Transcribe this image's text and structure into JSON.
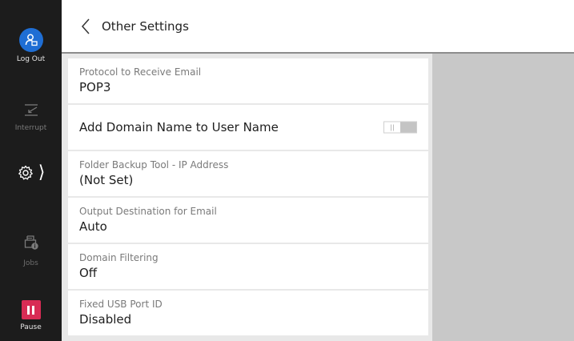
{
  "sidebar": {
    "logout_label": "Log Out",
    "interrupt_label": "Interrupt",
    "jobs_label": "Jobs",
    "pause_label": "Pause"
  },
  "header": {
    "title": "Other Settings"
  },
  "settings": {
    "protocol": {
      "label": "Protocol to Receive Email",
      "value": "POP3"
    },
    "domain_name": {
      "label": "Add Domain Name to User Name",
      "enabled": false
    },
    "folder_backup": {
      "label": "Folder Backup Tool - IP Address",
      "value": "(Not Set)"
    },
    "output_destination": {
      "label": "Output Destination for Email",
      "value": "Auto"
    },
    "domain_filtering": {
      "label": "Domain Filtering",
      "value": "Off"
    },
    "fixed_usb": {
      "label": "Fixed USB Port ID",
      "value": "Disabled"
    }
  },
  "colors": {
    "sidebar_bg": "#1c1c1c",
    "logout_accent": "#1f6ed4",
    "pause_accent": "#d82c55",
    "content_bg": "#e8e8e8",
    "side_panel_bg": "#c8c8c8"
  },
  "icons": {
    "logout": "user-logout-icon",
    "interrupt": "interrupt-icon",
    "settings": "gear-icon",
    "jobs": "printer-jobs-icon",
    "pause": "pause-icon",
    "back": "chevron-left-icon"
  }
}
